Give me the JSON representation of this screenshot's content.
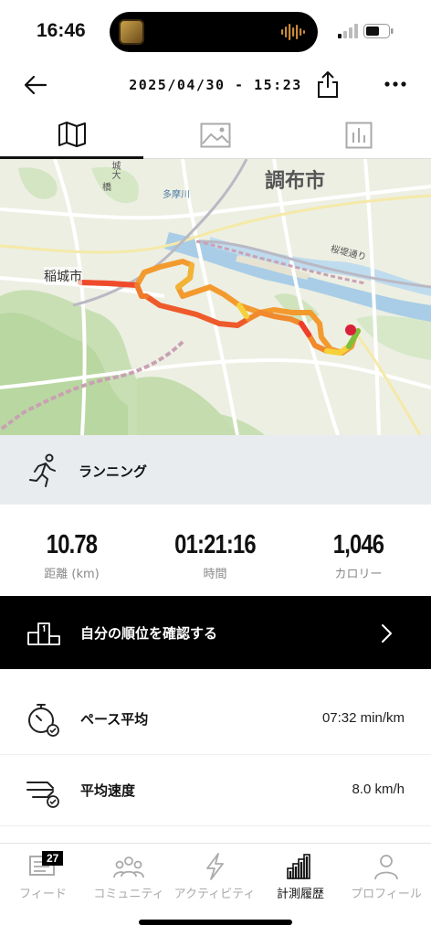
{
  "status_bar": {
    "time": "16:46"
  },
  "header": {
    "title": "2025/04/30 - 15:23"
  },
  "tabs": [
    {
      "icon": "map-icon",
      "active": true
    },
    {
      "icon": "image-icon",
      "active": false
    },
    {
      "icon": "chart-icon",
      "active": false
    }
  ],
  "map": {
    "labels": {
      "city_main": "調布市",
      "city_west": "稲城市",
      "river": "多摩川",
      "bridge_a": "城大",
      "bridge_b": "橋",
      "road": "桜堤通り"
    }
  },
  "activity": {
    "type": "ランニング"
  },
  "stats": [
    {
      "value": "10.78",
      "label": "距離 (km)"
    },
    {
      "value": "01:21:16",
      "label": "時間"
    },
    {
      "value": "1,046",
      "label": "カロリー"
    }
  ],
  "ranking": {
    "label": "自分の順位を確認する"
  },
  "metrics": [
    {
      "label": "ペース平均",
      "value": "07:32 min/km"
    },
    {
      "label": "平均速度",
      "value": "8.0 km/h"
    }
  ],
  "nav": {
    "badge": "27",
    "items": [
      {
        "label": "フィード",
        "active": false
      },
      {
        "label": "コミュニティ",
        "active": false
      },
      {
        "label": "アクティビティ",
        "active": false
      },
      {
        "label": "計測履歴",
        "active": true
      },
      {
        "label": "プロフィール",
        "active": false
      }
    ]
  }
}
